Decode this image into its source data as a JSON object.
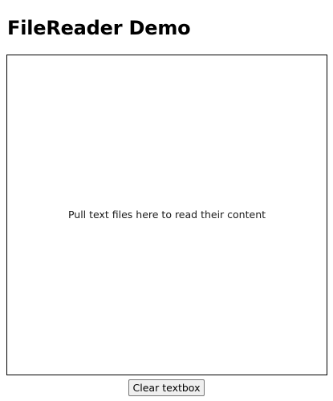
{
  "page": {
    "title": "FileReader Demo"
  },
  "drop_zone": {
    "prompt": "Pull text files here to read their content"
  },
  "controls": {
    "clear_label": "Clear textbox"
  }
}
